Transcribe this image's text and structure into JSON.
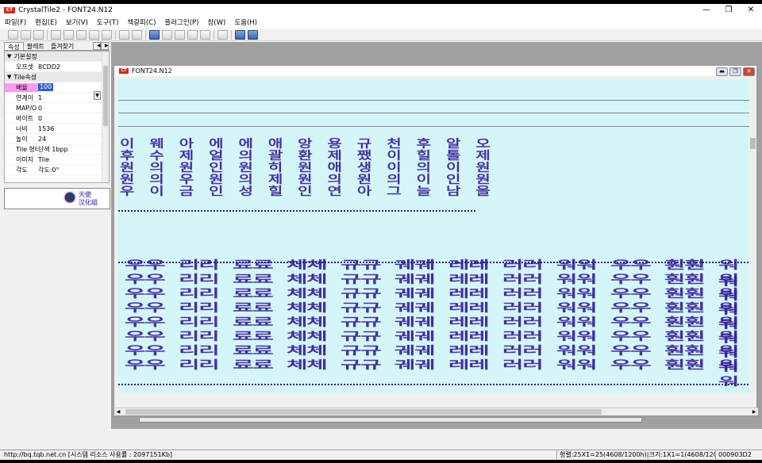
{
  "app": {
    "logo": "CT",
    "title": "CrystalTile2 - FONT24.N12"
  },
  "window_controls": {
    "minimize": "—",
    "maximize": "❐",
    "close": "✕"
  },
  "menu": [
    "파일(F)",
    "편집(E)",
    "보기(V)",
    "도구(T)",
    "책갈피(C)",
    "플러그인(P)",
    "창(W)",
    "도움(H)"
  ],
  "toolbar_icons": [
    "new-icon",
    "open-icon",
    "save-icon",
    "undo-icon",
    "cut-icon",
    "copy-icon",
    "paste-icon",
    "delete-icon",
    "find-icon",
    "replace-icon",
    "tile-view-icon",
    "font-icon",
    "palette-icon",
    "edit-icon",
    "image-icon",
    "print-icon",
    "grid-icon",
    "help-icon"
  ],
  "sidebar": {
    "tabs": [
      "속성",
      "팔레트",
      "즐겨찾기"
    ],
    "props": [
      {
        "type": "cat",
        "label": "기본설정"
      },
      {
        "key": "오프셋",
        "value": "8CDD2"
      },
      {
        "type": "cat",
        "label": "Tile속성"
      },
      {
        "key": "배율",
        "value": "100",
        "selected": true
      },
      {
        "key": "연계이",
        "value": "1"
      },
      {
        "key": "MAP/O",
        "value": "0"
      },
      {
        "key": "바이트",
        "value": "0"
      },
      {
        "key": "너비",
        "value": "1536"
      },
      {
        "key": "높이",
        "value": "24"
      },
      {
        "key": "Tile 형태",
        "value": "단색 1bpp"
      },
      {
        "key": "이미지",
        "value": "Tile"
      },
      {
        "key": "각도",
        "value": "각도:0°"
      }
    ],
    "logo_text": [
      "天使",
      "汉化组"
    ]
  },
  "child_window": {
    "logo": "CT",
    "title": "FONT24.N12"
  },
  "font_rows": [
    "이 웨 아 에 에 애 앙 용 규 천 후 알 오",
    "후 수 제 얼 의 괄 환 제 쨌 이 힐 톨 제",
    "원 의 원 인 원 히 원 애 생 이 의 이 원",
    "원 의 우 원 의 제 원 의 원 의 이 인 원",
    "우 이 금 인 성 힐 인 연 아 그 늘 남 올"
  ],
  "font_cols": [
    "우",
    "리",
    "료",
    "체",
    "규",
    "궤",
    "레",
    "러",
    "워",
    "우",
    "훤",
    "워"
  ],
  "statusbar": {
    "left": "http://bq.tqb.net.cn [시스템 리소스 사용률 : 2097151Kb]",
    "middle": "형렬:25X1=25(4608/1200h)|크기:1X1=1(4608/1200h)",
    "right": "000903D2"
  }
}
